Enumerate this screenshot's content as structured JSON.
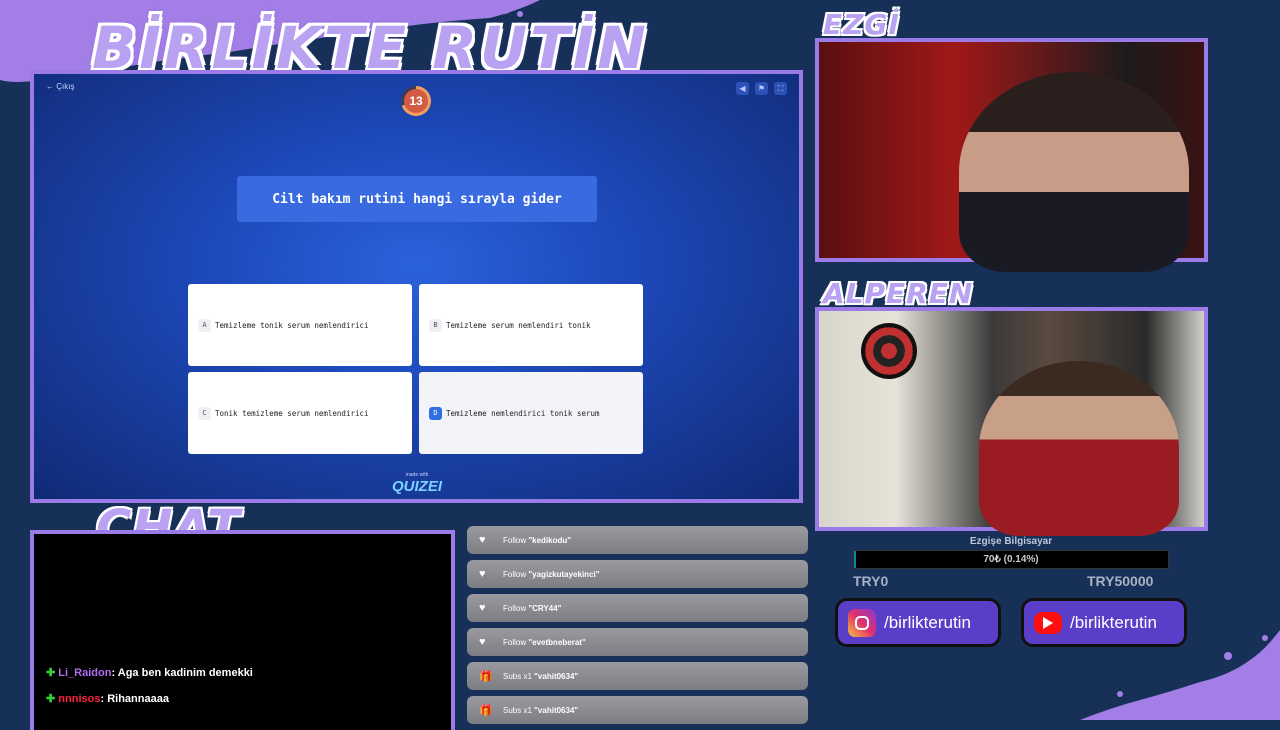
{
  "title": "BİRLİKTE RUTİN",
  "quiz": {
    "back_label": "← Çıkış",
    "timer": "13",
    "question": "Cilt bakım rutini hangi sırayla gider",
    "answers": [
      {
        "letter": "A",
        "text": "Temizleme tonik serum nemlendirici",
        "selected": false
      },
      {
        "letter": "B",
        "text": "Temizleme serum nemlendiri tonik",
        "selected": false
      },
      {
        "letter": "C",
        "text": "Tonik temizleme serum nemlendirici",
        "selected": false
      },
      {
        "letter": "D",
        "text": "Temizleme nemlendirici tonik serum",
        "selected": true
      }
    ],
    "made_with": "made with",
    "brand": "QUIZEI"
  },
  "cams": {
    "top_label": "EZGİ",
    "bottom_label": "ALPEREN"
  },
  "chat": {
    "label": "CHAT",
    "messages": [
      {
        "user": "Li_Raidon",
        "text": "Aga ben kadinim demekki"
      },
      {
        "user": "nnnisos",
        "text": "Rihannaaaa"
      }
    ]
  },
  "events": [
    {
      "icon": "heart-icon",
      "prefix": "Follow",
      "name": "\"kedikodu\""
    },
    {
      "icon": "heart-icon",
      "prefix": "Follow",
      "name": "\"yagizkutayekinci\""
    },
    {
      "icon": "heart-icon",
      "prefix": "Follow",
      "name": "\"CRY44\""
    },
    {
      "icon": "heart-icon",
      "prefix": "Follow",
      "name": "\"evetbneberat\""
    },
    {
      "icon": "gift-icon",
      "prefix": "Subs x1",
      "name": "\"vahit0634\""
    },
    {
      "icon": "gift-icon",
      "prefix": "Subs x1",
      "name": "\"vahit0634\""
    }
  ],
  "donation": {
    "title": "Ezgişe Bilgisayar",
    "current": "70₺ (0.14%)",
    "progress_fraction": 0.0014,
    "min": "TRY0",
    "max": "TRY50000"
  },
  "socials": {
    "instagram": "/birlikterutin",
    "youtube": "/birlikterutin"
  },
  "colors": {
    "background": "#163058",
    "frame": "#9a7be8",
    "label": "#b9a2f2",
    "quiz_blue": "#1d48b8",
    "selected_letter": "#2f6fe0"
  }
}
